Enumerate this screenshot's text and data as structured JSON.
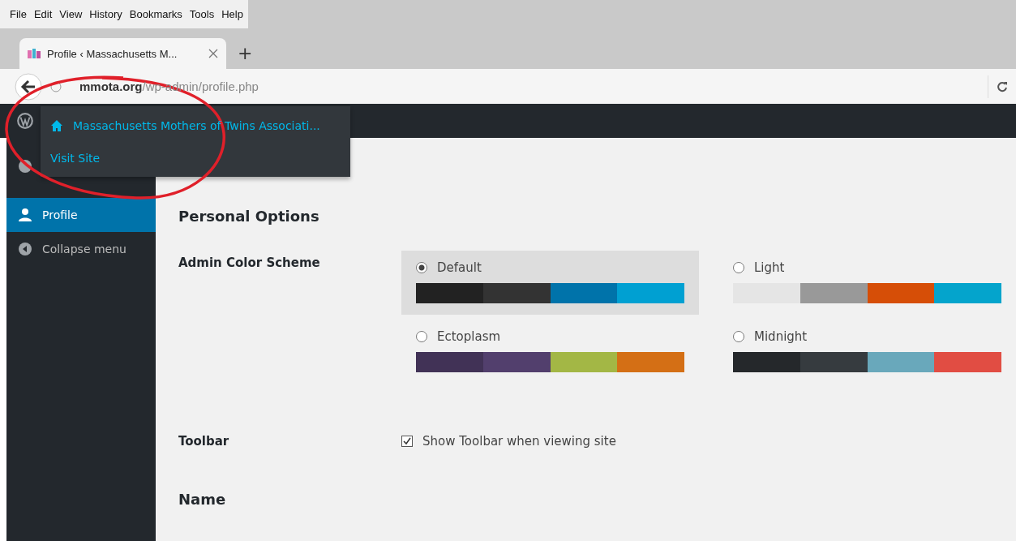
{
  "menu_bar": [
    "File",
    "Edit",
    "View",
    "History",
    "Bookmarks",
    "Tools",
    "Help"
  ],
  "tabs": [
    {
      "title": "Profile ‹ Massachusetts M...",
      "selected": true
    }
  ],
  "new_tab": "+",
  "address_bar": {
    "domain": "mmota.org",
    "path": "/wp-admin/profile.php"
  },
  "site_menu": {
    "site_name": "Massachusetts Mothers of Twins Associati...",
    "items": [
      "Visit Site"
    ]
  },
  "sidebar": [
    {
      "kind": "dashboard",
      "selected": false
    },
    {
      "kind": "profile",
      "label": "Profile",
      "selected": true
    },
    {
      "kind": "collapse",
      "label": "Collapse menu",
      "selected": false
    }
  ],
  "section_title": "Personal Options",
  "color_scheme": {
    "label": "Admin Color Scheme",
    "options": [
      {
        "name": "Default",
        "selected": true,
        "swatches": [
          {
            "color": "#222222"
          },
          {
            "color": "#333333"
          },
          {
            "color": "#0073aa"
          },
          {
            "color": "#00a0d2"
          }
        ]
      },
      {
        "name": "Light",
        "selected": false,
        "swatches": [
          {
            "color": "#e5e5e5"
          },
          {
            "color": "#999999"
          },
          {
            "color": "#d64e07"
          },
          {
            "color": "#04a4cc"
          }
        ]
      },
      {
        "name": "Ectoplasm",
        "selected": false,
        "swatches": [
          {
            "color": "#413256"
          },
          {
            "color": "#523f6d"
          },
          {
            "color": "#a3b745"
          },
          {
            "color": "#d46f15"
          }
        ]
      },
      {
        "name": "Midnight",
        "selected": false,
        "swatches": [
          {
            "color": "#25282b"
          },
          {
            "color": "#363b3f"
          },
          {
            "color": "#69a8bb"
          },
          {
            "color": "#e14d43"
          }
        ]
      }
    ]
  },
  "toolbar": {
    "label": "Toolbar",
    "option": "Show Toolbar when viewing site",
    "checked": true
  },
  "name_heading": "Name"
}
